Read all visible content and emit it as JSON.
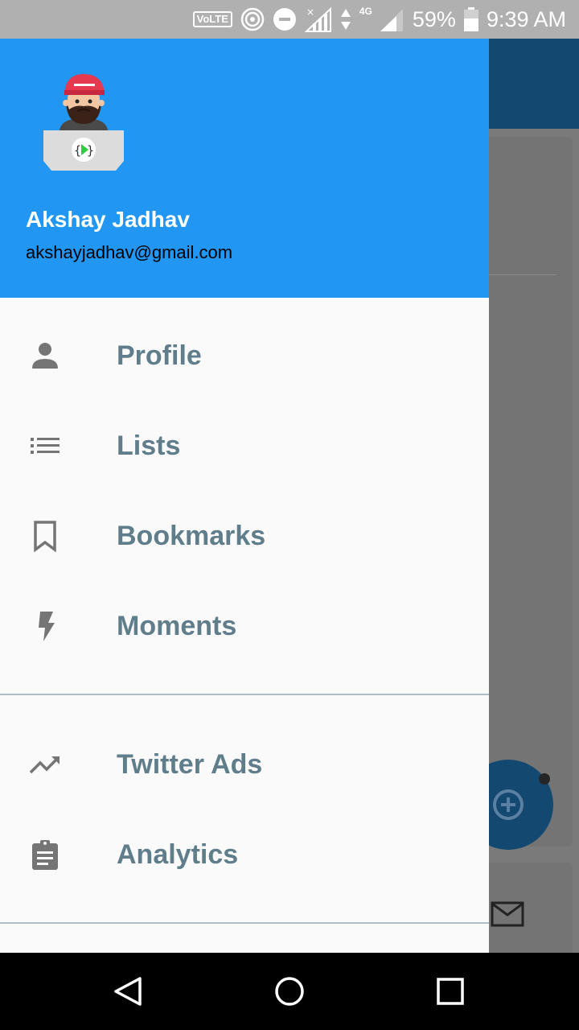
{
  "status_bar": {
    "volte": "VoLTE",
    "network": "4G",
    "battery_percent": "59%",
    "time": "9:39 AM"
  },
  "drawer": {
    "header": {
      "name": "Akshay Jadhav",
      "email": "akshayjadhav@gmail.com",
      "avatar_icon": "developer-avatar-icon"
    },
    "items": [
      {
        "label": "Profile",
        "icon": "person-icon"
      },
      {
        "label": "Lists",
        "icon": "list-icon"
      },
      {
        "label": "Bookmarks",
        "icon": "bookmark-icon"
      },
      {
        "label": "Moments",
        "icon": "lightning-icon"
      },
      {
        "label": "Twitter Ads",
        "icon": "trending-up-icon"
      },
      {
        "label": "Analytics",
        "icon": "clipboard-icon"
      }
    ]
  },
  "colors": {
    "header_blue": "#2196f3",
    "menu_text": "#607d8b",
    "menu_icon": "#757575",
    "divider": "#b0bec5"
  },
  "nav_bar": {
    "buttons": [
      "back",
      "home",
      "recents"
    ]
  }
}
